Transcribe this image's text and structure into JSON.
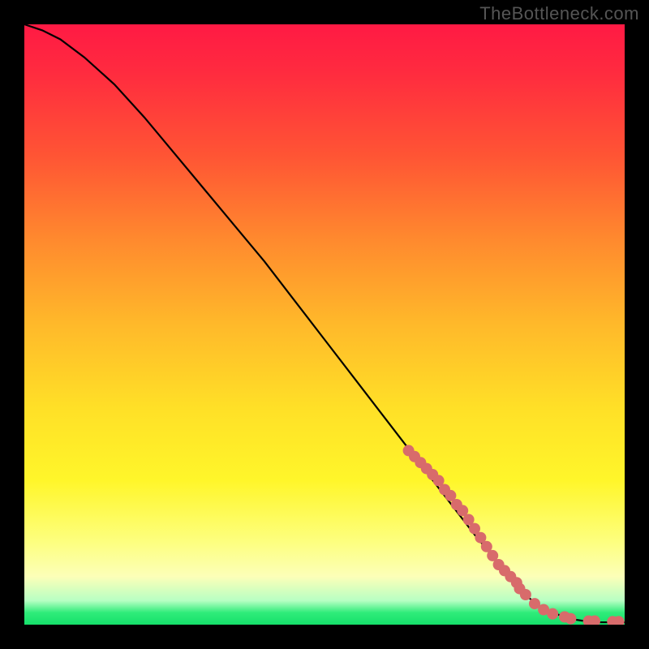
{
  "watermark": "TheBottleneck.com",
  "chart_data": {
    "type": "line",
    "title": "",
    "xlabel": "",
    "ylabel": "",
    "xlim": [
      0,
      100
    ],
    "ylim": [
      0,
      100
    ],
    "curve": {
      "x": [
        0,
        3,
        6,
        10,
        15,
        20,
        25,
        30,
        35,
        40,
        45,
        50,
        55,
        60,
        65,
        70,
        75,
        80,
        82,
        84,
        86,
        88,
        90,
        92,
        94,
        96,
        98,
        100
      ],
      "y": [
        100,
        99,
        97.5,
        94.5,
        90,
        84.5,
        78.5,
        72.5,
        66.5,
        60.5,
        54,
        47.5,
        41,
        34.5,
        28,
        21.5,
        15,
        9,
        6.5,
        4.5,
        3,
        2,
        1.3,
        0.8,
        0.5,
        0.4,
        0.4,
        0.4
      ]
    },
    "points": {
      "x": [
        64,
        65,
        66,
        67,
        68,
        69,
        70,
        71,
        72,
        73,
        74,
        75,
        76,
        77,
        78,
        79,
        80,
        81,
        82,
        82.5,
        83.5,
        85,
        86.5,
        88,
        90,
        91,
        94,
        95,
        98,
        99
      ],
      "y": [
        29,
        28,
        27,
        26,
        25,
        24,
        22.5,
        21.5,
        20,
        19,
        17.5,
        16,
        14.5,
        13,
        11.5,
        10,
        9,
        8,
        7,
        6,
        5,
        3.5,
        2.5,
        1.8,
        1.3,
        1.0,
        0.6,
        0.6,
        0.5,
        0.5
      ]
    },
    "point_color": "#d86b6b",
    "line_color": "#000000"
  }
}
